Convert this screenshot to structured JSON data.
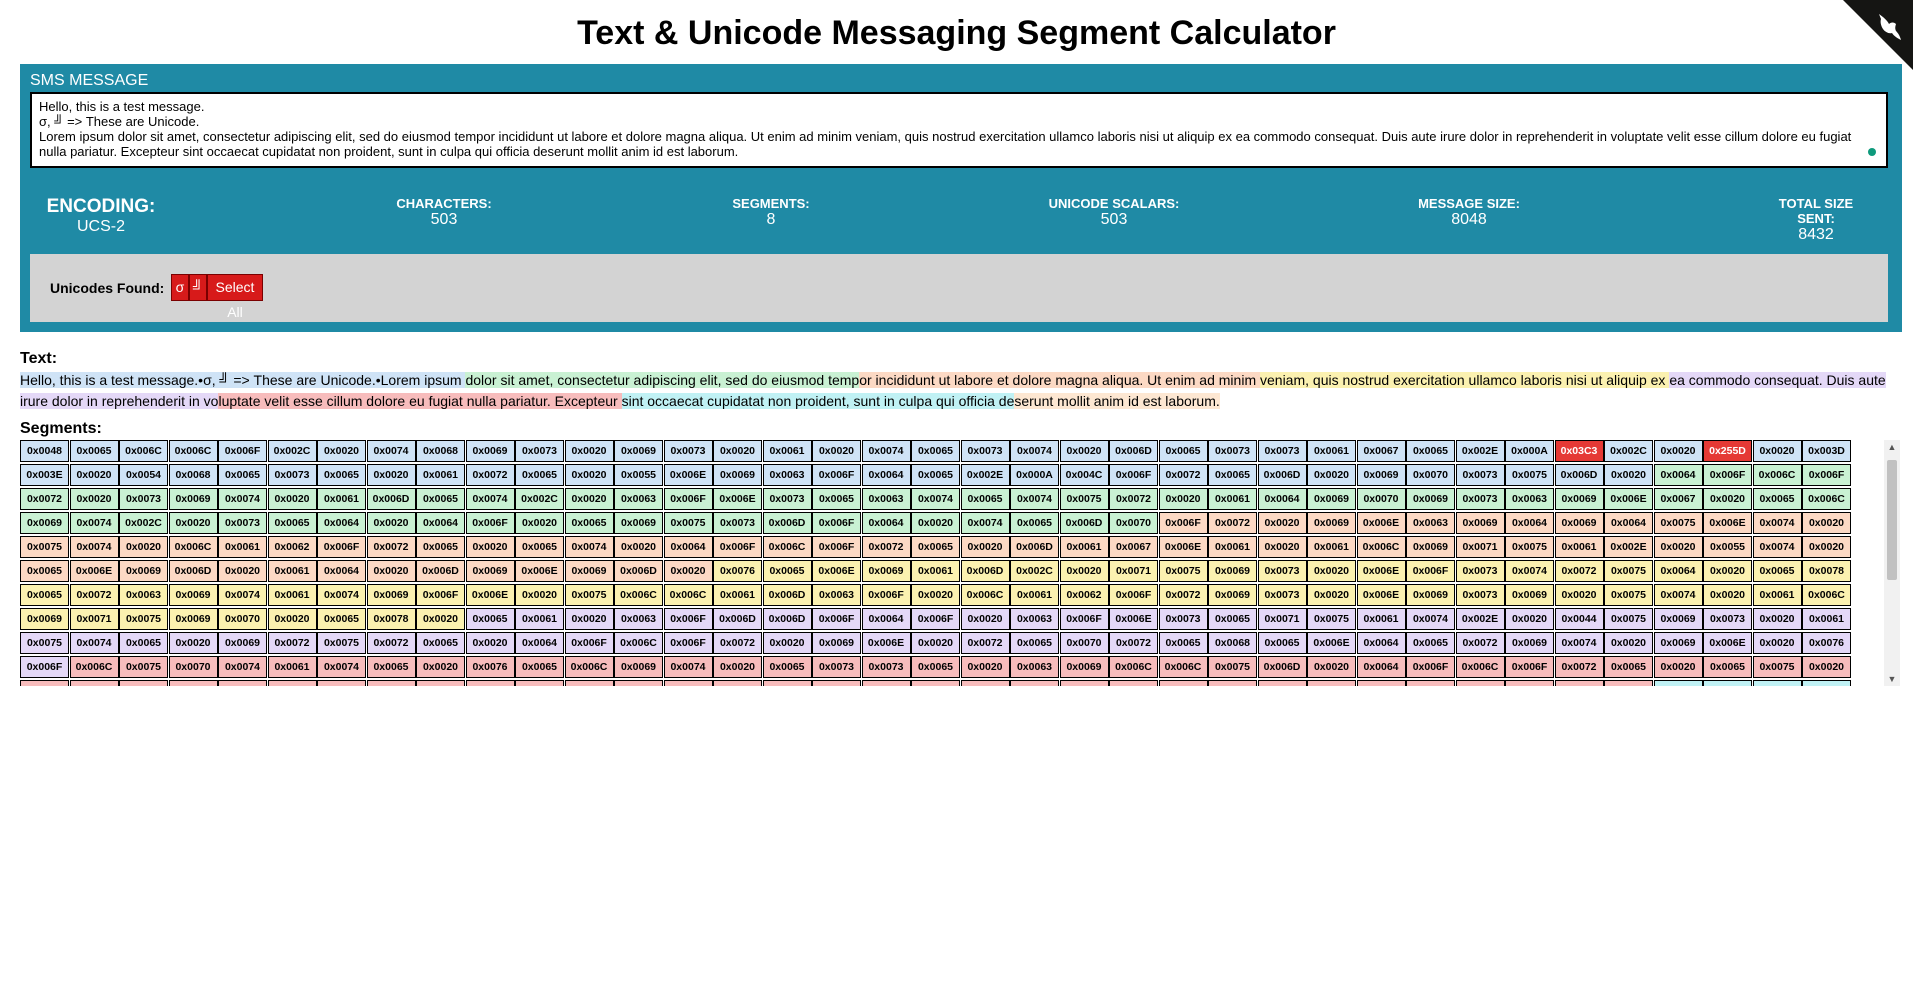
{
  "title": "Text & Unicode Messaging Segment Calculator",
  "sms": {
    "label": "SMS MESSAGE",
    "message": "Hello, this is a test message.\nσ, ╝ => These are Unicode.\nLorem ipsum dolor sit amet, consectetur adipiscing elit, sed do eiusmod tempor incididunt ut labore et dolore magna aliqua. Ut enim ad minim veniam, quis nostrud exercitation ullamco laboris nisi ut aliquip ex ea commodo consequat. Duis aute irure dolor in reprehenderit in voluptate velit esse cillum dolore eu fugiat nulla pariatur. Excepteur sint occaecat cupidatat non proident, sunt in culpa qui officia deserunt mollit anim id est laborum."
  },
  "stats": {
    "encoding": {
      "label": "ENCODING:",
      "value": "UCS-2"
    },
    "characters": {
      "label": "CHARACTERS:",
      "value": "503"
    },
    "segments": {
      "label": "SEGMENTS:",
      "value": "8"
    },
    "scalars": {
      "label": "UNICODE SCALARS:",
      "value": "503"
    },
    "message_size": {
      "label": "MESSAGE SIZE:",
      "value": "8048"
    },
    "total_size": {
      "label": "TOTAL SIZE SENT:",
      "value": "8432"
    }
  },
  "unicodes_found": {
    "label": "Unicodes Found:",
    "chars": [
      "σ",
      "╝"
    ],
    "select_all": "Select All"
  },
  "text_section": {
    "label": "Text:",
    "segments": [
      "Hello, this is a test message.•σ, ╝ => These are Unicode.•Lorem ipsum ",
      "dolor sit amet, consectetur adipiscing elit, sed do eiusmod temp",
      "or incididunt ut labore et dolore magna aliqua. Ut enim ad minim ",
      "veniam, quis nostrud exercitation ullamco laboris nisi ut aliquip ex ",
      "ea commodo consequat. Duis aute irure dolor in reprehenderit in vo",
      "luptate velit esse cillum dolore eu fugiat nulla pariatur. Excepteur ",
      "sint occaecat cupidatat non proident, sunt in culpa qui officia de",
      "serunt mollit anim id est laborum."
    ]
  },
  "segments_section": {
    "label": "Segments:"
  },
  "colors": {
    "panel": "#1f8aa5",
    "segment_colors": [
      "#cfe3f6",
      "#c9f1d3",
      "#fcd9c4",
      "#fbf1b0",
      "#e4d8f7",
      "#f7bcbc",
      "#c0f1f4",
      "#fde7d2"
    ],
    "unicode_highlight": "#e53935"
  }
}
